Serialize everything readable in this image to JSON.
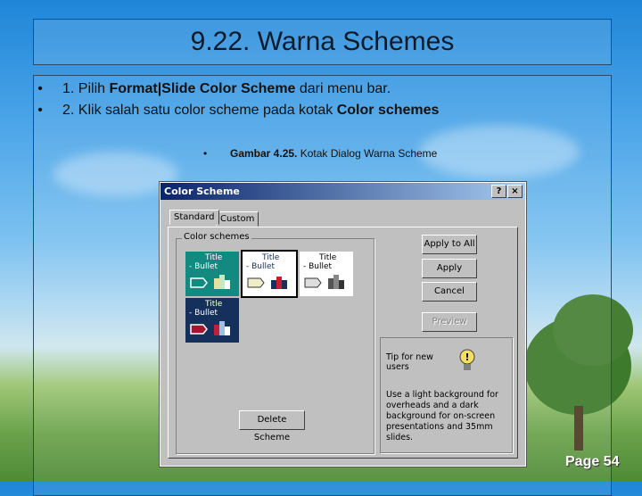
{
  "slide": {
    "title": "9.22. Warna Schemes",
    "bullets": [
      {
        "marker": "•",
        "prefix": "1. Pilih ",
        "bold": "Format|Slide Color Scheme",
        "suffix": " dari menu bar."
      },
      {
        "marker": "•",
        "prefix": "2. Klik salah satu color scheme pada kotak ",
        "bold": "Color schemes",
        "suffix": ""
      }
    ],
    "caption": {
      "marker": "•",
      "bold": "Gambar 4.25.",
      "text": " Kotak Dialog Warna Scheme"
    },
    "page_label": "Page 54"
  },
  "dialog": {
    "title": "Color Scheme",
    "help_button": "?",
    "close_button": "×",
    "tabs": [
      "Standard",
      "Custom"
    ],
    "group_label": "Color schemes",
    "scheme_title": "Title",
    "scheme_bullet": "- Bullet",
    "buttons": {
      "apply_to_all": "Apply to All",
      "apply": "Apply",
      "cancel": "Cancel",
      "preview": "Preview",
      "delete_scheme": "Delete Scheme"
    },
    "tip": {
      "heading": "Tip for new users",
      "body": "Use a light background for overheads and a dark background for on-screen presentations and 35mm slides."
    }
  },
  "colors": {
    "title_bar_start": "#0a246a",
    "title_bar_end": "#a6caf0",
    "scheme_teal": "#138a80",
    "scheme_navy": "#15305a",
    "scheme_white": "#ffffff"
  }
}
